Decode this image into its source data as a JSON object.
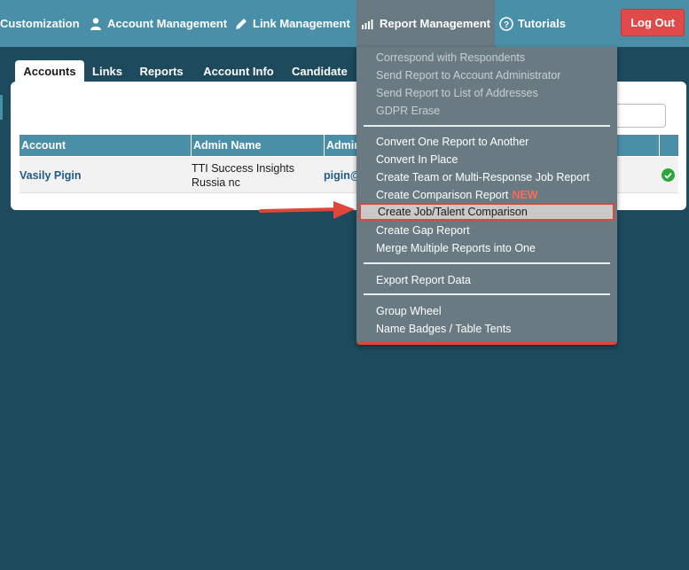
{
  "nav": {
    "customization": "Customization",
    "account_management": "Account Management",
    "link_management": "Link Management",
    "report_management": "Report Management",
    "tutorials": "Tutorials",
    "logout": "Log Out"
  },
  "tabs": [
    "Accounts",
    "Links",
    "Reports",
    "Account Info",
    "Candidate"
  ],
  "table": {
    "headers": [
      "Account",
      "Admin Name",
      "Admin"
    ],
    "row": {
      "account": "Vasily Pigin",
      "admin_name_line1": "TTI Success Insights",
      "admin_name_line2": "Russia nc",
      "admin_email": "pigin@"
    }
  },
  "menu": {
    "group1": [
      "Correspond with Respondents",
      "Send Report to Account Administrator",
      "Send Report to List of Addresses",
      "GDPR Erase"
    ],
    "group2": [
      "Convert One Report to Another",
      "Convert In Place",
      "Create Team or Multi-Response Job Report",
      "Create Comparison Report",
      "Create Job/Talent Comparison",
      "Create Gap Report",
      "Merge Multiple Reports into One"
    ],
    "new_badge": "NEW",
    "group3": [
      "Export Report Data"
    ],
    "group4": [
      "Group Wheel",
      "Name Badges / Table Tents"
    ]
  },
  "colors": {
    "nav_bg": "#4a8fa8",
    "page_bg": "#1d4a5c",
    "menu_bg": "#6a7a82",
    "accent_red": "#e0453a",
    "logout_red": "#e04a4a"
  }
}
